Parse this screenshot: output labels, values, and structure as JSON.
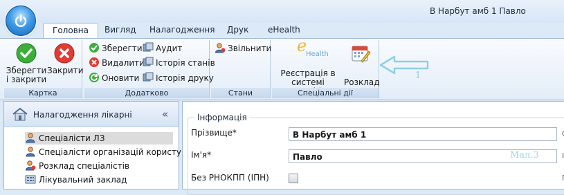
{
  "window": {
    "title": "В Нарбут амб 1 Павло"
  },
  "tabs": [
    {
      "label": "Головна",
      "active": true
    },
    {
      "label": "Вигляд"
    },
    {
      "label": "Налагодження"
    },
    {
      "label": "Друк"
    },
    {
      "label": "eHealth"
    }
  ],
  "ribbon": {
    "kartka": {
      "label": "Картка",
      "save_close": "Зберегти\nі закрити",
      "close": "Закрити"
    },
    "dodatkovo": {
      "label": "Додатково",
      "save": "Зберегти",
      "delete": "Видалити",
      "refresh": "Оновити",
      "audit": "Аудит",
      "state_history": "Історія станів",
      "print_history": "Історія друку"
    },
    "stany": {
      "label": "Стани",
      "release": "Звільнити"
    },
    "special": {
      "label": "Спеціальні дії",
      "ehealth_register": "Реєстрація в\nсистемі \"eHealth\"",
      "schedule": "Розклад",
      "ehealth_logo": "Health"
    }
  },
  "annotation": {
    "number": "1",
    "mal": "Мал.3"
  },
  "left_panel": {
    "title": "Налагодження лікарні",
    "collapse": "«",
    "items": [
      {
        "label": "Спеціалісти ЛЗ",
        "selected": true
      },
      {
        "label": "Спеціалісти організацій користувач"
      },
      {
        "label": "Розклад спеціалістів"
      },
      {
        "label": "Лікувальний заклад"
      }
    ]
  },
  "form": {
    "section": "Інформація",
    "surname_label": "Прізвище*",
    "surname_value": "В Нарбут амб 1",
    "name_label": "Ім'я*",
    "name_value": "Павло",
    "no_rnokpp_label": "Без РНОКПП (ІПН)",
    "edge_letters": [
      "С",
      "І",
      "П"
    ]
  },
  "colors": {
    "accent": "#3f9ae6",
    "ribbon_border": "#9db7d6",
    "annotation": "#8fcfe3"
  }
}
